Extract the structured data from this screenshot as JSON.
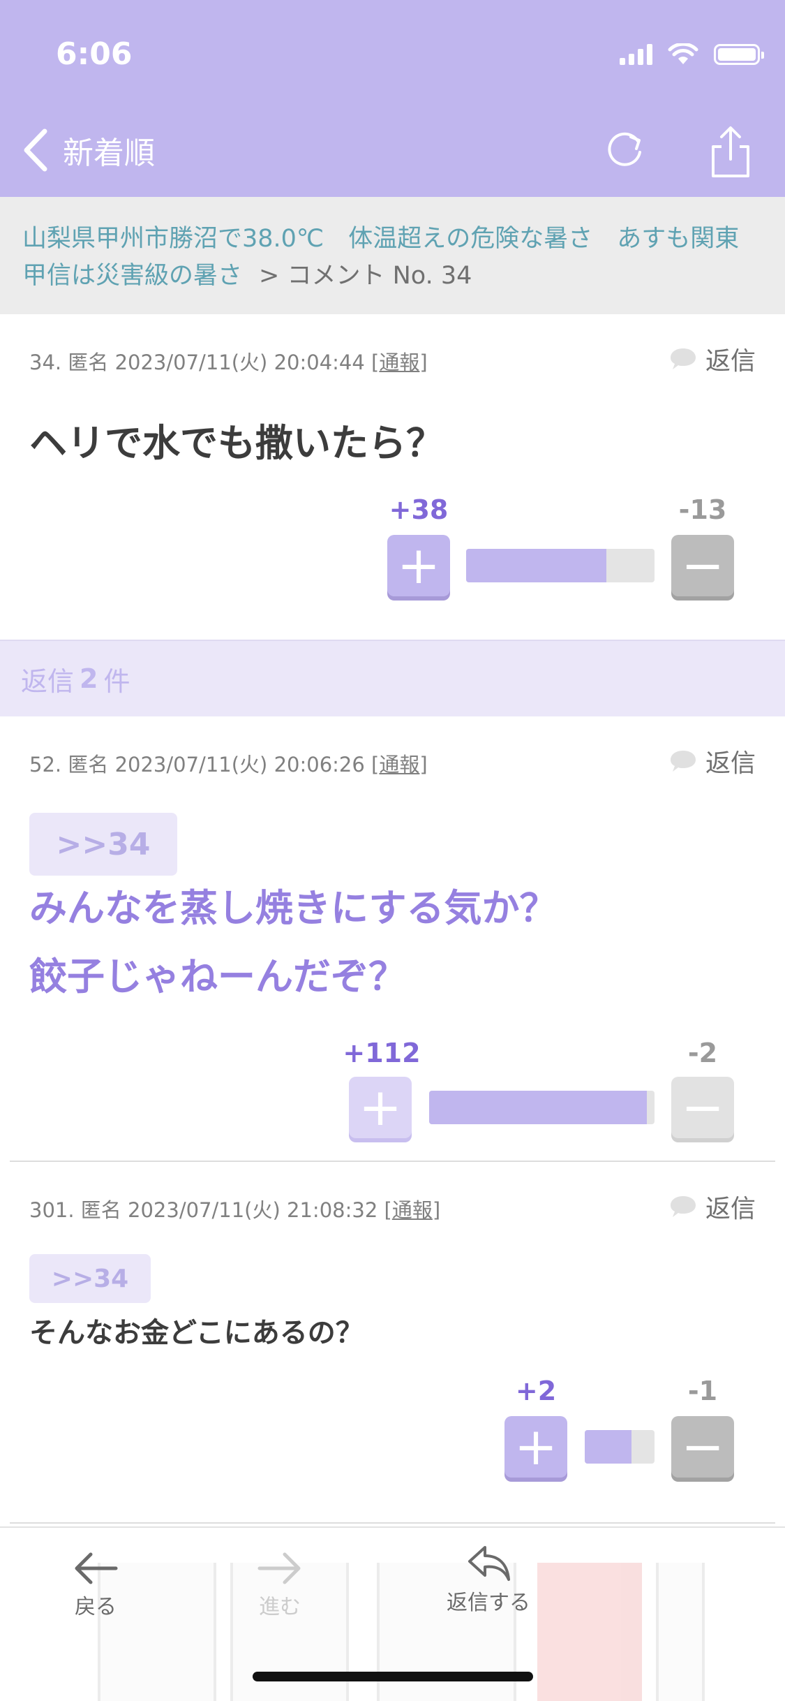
{
  "status_bar": {
    "time": "6:06"
  },
  "nav": {
    "back_label": "新着順"
  },
  "breadcrumb": {
    "article_title": "山梨県甲州市勝沼で38.0℃　体温超えの危険な暑さ　あすも関東甲信は災害級の暑さ",
    "separator": ">",
    "current": "コメント No. 34"
  },
  "comments": [
    {
      "number": "34.",
      "author": "匿名",
      "datetime": "2023/07/11(火) 20:04:44",
      "report_open": "[",
      "report_label": "通報",
      "report_close": "]",
      "reply_label": "返信",
      "body": "ヘリで水でも撒いたら？",
      "plus_label": "+38",
      "minus_label": "-13",
      "plus_ratio": 0.745
    },
    {
      "number": "52.",
      "author": "匿名",
      "datetime": "2023/07/11(火) 20:06:26",
      "report_open": "[",
      "report_label": "通報",
      "report_close": "]",
      "reply_label": "返信",
      "anchor": ">>34",
      "body_line1": "みんなを蒸し焼きにする気か？",
      "body_line2": "餃子じゃねーんだぞ？",
      "plus_label": "+112",
      "minus_label": "-2",
      "plus_ratio": 0.965
    },
    {
      "number": "301.",
      "author": "匿名",
      "datetime": "2023/07/11(火) 21:08:32",
      "report_open": "[",
      "report_label": "通報",
      "report_close": "]",
      "reply_label": "返信",
      "anchor": ">>34",
      "body": "そんなお金どこにあるの？",
      "plus_label": "+2",
      "minus_label": "-1",
      "plus_ratio": 0.667
    }
  ],
  "replies": {
    "prefix": "返信",
    "count": "2",
    "suffix": "件"
  },
  "toolbar": {
    "back": "戻る",
    "forward": "進む",
    "reply": "返信する"
  },
  "colors": {
    "accent": "#c0b6ee",
    "accent_text": "#8068d8",
    "link": "#5fa2b2"
  },
  "icons": [
    "chevron-left-icon",
    "reload-icon",
    "share-icon",
    "speech-bubble-icon",
    "plus-icon",
    "minus-icon",
    "arrow-left-icon",
    "arrow-right-icon",
    "reply-arrow-icon"
  ]
}
